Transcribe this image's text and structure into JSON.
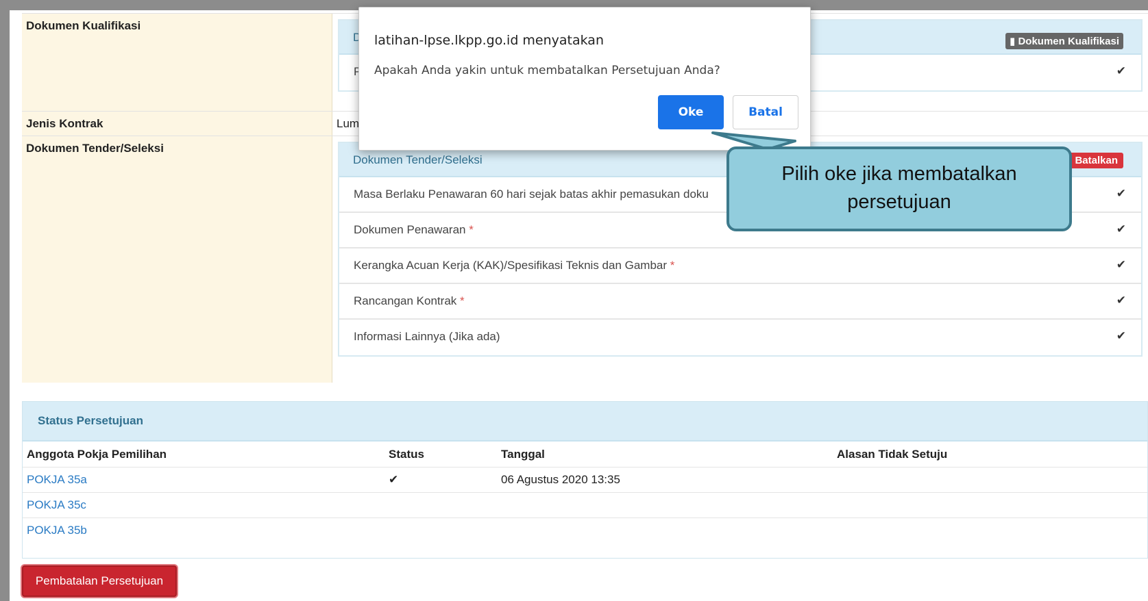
{
  "detail": {
    "kualifikasi": {
      "label": "Dokumen Kualifikasi",
      "panel_title_partial": "D",
      "item_partial": "P",
      "badge": "Dokumen Kualifikasi"
    },
    "jenis_kontrak": {
      "label": "Jenis Kontrak",
      "value_partial": "Lum"
    },
    "tender": {
      "label": "Dokumen Tender/Seleksi",
      "panel_title": "Dokumen Tender/Seleksi",
      "badge": "Batalkan",
      "items": [
        {
          "text": "Masa Berlaku Penawaran 60 hari sejak batas akhir pemasukan doku",
          "required": ""
        },
        {
          "text": "Dokumen Penawaran",
          "required": "*"
        },
        {
          "text": "Kerangka Acuan Kerja (KAK)/Spesifikasi Teknis dan Gambar",
          "required": "*"
        },
        {
          "text": "Rancangan Kontrak",
          "required": "*"
        },
        {
          "text": "Informasi Lainnya (Jika ada)",
          "required": ""
        }
      ]
    }
  },
  "status": {
    "title": "Status Persetujuan",
    "columns": [
      "Anggota Pokja Pemilihan",
      "Status",
      "Tanggal",
      "Alasan Tidak Setuju"
    ],
    "rows": [
      {
        "member": "POKJA 35a",
        "status": "✔",
        "date": "06 Agustus 2020 13:35",
        "reason": ""
      },
      {
        "member": "POKJA 35c",
        "status": "",
        "date": "",
        "reason": ""
      },
      {
        "member": "POKJA 35b",
        "status": "",
        "date": "",
        "reason": ""
      }
    ]
  },
  "cancel_button": "Pembatalan Persetujuan",
  "dialog": {
    "title": "latihan-lpse.lkpp.go.id menyatakan",
    "message": "Apakah Anda yakin untuk membatalkan Persetujuan Anda?",
    "ok": "Oke",
    "cancel": "Batal"
  },
  "callout": {
    "text": "Pilih oke jika membatalkan persetujuan"
  },
  "icons": {
    "check": "check-icon",
    "document": "document-icon"
  },
  "colors": {
    "label_bg": "#fdf6e3",
    "panel_head": "#d9edf7",
    "danger": "#c9252f",
    "dialog_primary": "#1a73e8",
    "callout": "#92cddd"
  }
}
